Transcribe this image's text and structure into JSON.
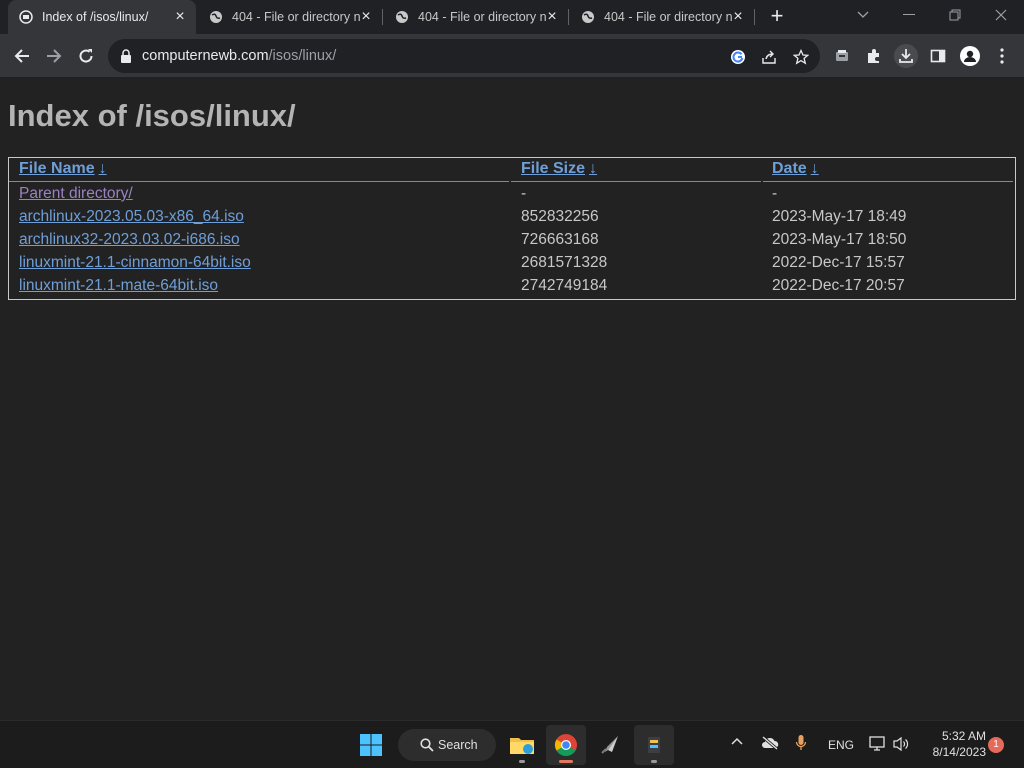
{
  "tabs": [
    {
      "title": "Index of /isos/linux/",
      "active": true,
      "icon": "folder-tab-icon"
    },
    {
      "title": "404 - File or directory n",
      "active": false,
      "icon": "globe-icon"
    },
    {
      "title": "404 - File or directory n",
      "active": false,
      "icon": "globe-icon"
    },
    {
      "title": "404 - File or directory n",
      "active": false,
      "icon": "globe-icon"
    }
  ],
  "address": {
    "domain": "computernewb.com",
    "path": "/isos/linux/"
  },
  "page": {
    "heading": "Index of /isos/linux/",
    "columns": {
      "name": "File Name",
      "size": "File Size",
      "date": "Date",
      "sort_arrow": "↓"
    },
    "rows": [
      {
        "name": "Parent directory/",
        "size": "-",
        "date": "-"
      },
      {
        "name": "archlinux-2023.05.03-x86_64.iso",
        "size": "852832256",
        "date": "2023-May-17 18:49"
      },
      {
        "name": "archlinux32-2023.03.02-i686.iso",
        "size": "726663168",
        "date": "2023-May-17 18:50"
      },
      {
        "name": "linuxmint-21.1-cinnamon-64bit.iso",
        "size": "2681571328",
        "date": "2022-Dec-17 15:57"
      },
      {
        "name": "linuxmint-21.1-mate-64bit.iso",
        "size": "2742749184",
        "date": "2022-Dec-17 20:57"
      }
    ]
  },
  "taskbar": {
    "search_label": "Search",
    "language": "ENG",
    "time": "5:32 AM",
    "date": "8/14/2023",
    "notifications": "1"
  },
  "colors": {
    "link": "#6f9fd8",
    "visited": "#9a82c0",
    "page_bg": "#222222"
  }
}
